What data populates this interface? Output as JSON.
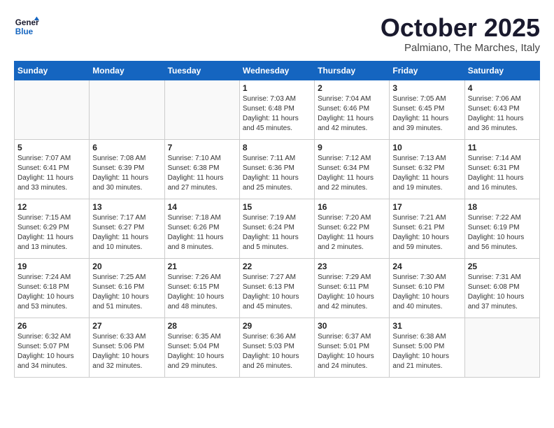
{
  "header": {
    "logo_line1": "General",
    "logo_line2": "Blue",
    "month": "October 2025",
    "location": "Palmiano, The Marches, Italy"
  },
  "weekdays": [
    "Sunday",
    "Monday",
    "Tuesday",
    "Wednesday",
    "Thursday",
    "Friday",
    "Saturday"
  ],
  "weeks": [
    [
      {
        "day": "",
        "info": ""
      },
      {
        "day": "",
        "info": ""
      },
      {
        "day": "",
        "info": ""
      },
      {
        "day": "1",
        "info": "Sunrise: 7:03 AM\nSunset: 6:48 PM\nDaylight: 11 hours and 45 minutes."
      },
      {
        "day": "2",
        "info": "Sunrise: 7:04 AM\nSunset: 6:46 PM\nDaylight: 11 hours and 42 minutes."
      },
      {
        "day": "3",
        "info": "Sunrise: 7:05 AM\nSunset: 6:45 PM\nDaylight: 11 hours and 39 minutes."
      },
      {
        "day": "4",
        "info": "Sunrise: 7:06 AM\nSunset: 6:43 PM\nDaylight: 11 hours and 36 minutes."
      }
    ],
    [
      {
        "day": "5",
        "info": "Sunrise: 7:07 AM\nSunset: 6:41 PM\nDaylight: 11 hours and 33 minutes."
      },
      {
        "day": "6",
        "info": "Sunrise: 7:08 AM\nSunset: 6:39 PM\nDaylight: 11 hours and 30 minutes."
      },
      {
        "day": "7",
        "info": "Sunrise: 7:10 AM\nSunset: 6:38 PM\nDaylight: 11 hours and 27 minutes."
      },
      {
        "day": "8",
        "info": "Sunrise: 7:11 AM\nSunset: 6:36 PM\nDaylight: 11 hours and 25 minutes."
      },
      {
        "day": "9",
        "info": "Sunrise: 7:12 AM\nSunset: 6:34 PM\nDaylight: 11 hours and 22 minutes."
      },
      {
        "day": "10",
        "info": "Sunrise: 7:13 AM\nSunset: 6:32 PM\nDaylight: 11 hours and 19 minutes."
      },
      {
        "day": "11",
        "info": "Sunrise: 7:14 AM\nSunset: 6:31 PM\nDaylight: 11 hours and 16 minutes."
      }
    ],
    [
      {
        "day": "12",
        "info": "Sunrise: 7:15 AM\nSunset: 6:29 PM\nDaylight: 11 hours and 13 minutes."
      },
      {
        "day": "13",
        "info": "Sunrise: 7:17 AM\nSunset: 6:27 PM\nDaylight: 11 hours and 10 minutes."
      },
      {
        "day": "14",
        "info": "Sunrise: 7:18 AM\nSunset: 6:26 PM\nDaylight: 11 hours and 8 minutes."
      },
      {
        "day": "15",
        "info": "Sunrise: 7:19 AM\nSunset: 6:24 PM\nDaylight: 11 hours and 5 minutes."
      },
      {
        "day": "16",
        "info": "Sunrise: 7:20 AM\nSunset: 6:22 PM\nDaylight: 11 hours and 2 minutes."
      },
      {
        "day": "17",
        "info": "Sunrise: 7:21 AM\nSunset: 6:21 PM\nDaylight: 10 hours and 59 minutes."
      },
      {
        "day": "18",
        "info": "Sunrise: 7:22 AM\nSunset: 6:19 PM\nDaylight: 10 hours and 56 minutes."
      }
    ],
    [
      {
        "day": "19",
        "info": "Sunrise: 7:24 AM\nSunset: 6:18 PM\nDaylight: 10 hours and 53 minutes."
      },
      {
        "day": "20",
        "info": "Sunrise: 7:25 AM\nSunset: 6:16 PM\nDaylight: 10 hours and 51 minutes."
      },
      {
        "day": "21",
        "info": "Sunrise: 7:26 AM\nSunset: 6:15 PM\nDaylight: 10 hours and 48 minutes."
      },
      {
        "day": "22",
        "info": "Sunrise: 7:27 AM\nSunset: 6:13 PM\nDaylight: 10 hours and 45 minutes."
      },
      {
        "day": "23",
        "info": "Sunrise: 7:29 AM\nSunset: 6:11 PM\nDaylight: 10 hours and 42 minutes."
      },
      {
        "day": "24",
        "info": "Sunrise: 7:30 AM\nSunset: 6:10 PM\nDaylight: 10 hours and 40 minutes."
      },
      {
        "day": "25",
        "info": "Sunrise: 7:31 AM\nSunset: 6:08 PM\nDaylight: 10 hours and 37 minutes."
      }
    ],
    [
      {
        "day": "26",
        "info": "Sunrise: 6:32 AM\nSunset: 5:07 PM\nDaylight: 10 hours and 34 minutes."
      },
      {
        "day": "27",
        "info": "Sunrise: 6:33 AM\nSunset: 5:06 PM\nDaylight: 10 hours and 32 minutes."
      },
      {
        "day": "28",
        "info": "Sunrise: 6:35 AM\nSunset: 5:04 PM\nDaylight: 10 hours and 29 minutes."
      },
      {
        "day": "29",
        "info": "Sunrise: 6:36 AM\nSunset: 5:03 PM\nDaylight: 10 hours and 26 minutes."
      },
      {
        "day": "30",
        "info": "Sunrise: 6:37 AM\nSunset: 5:01 PM\nDaylight: 10 hours and 24 minutes."
      },
      {
        "day": "31",
        "info": "Sunrise: 6:38 AM\nSunset: 5:00 PM\nDaylight: 10 hours and 21 minutes."
      },
      {
        "day": "",
        "info": ""
      }
    ]
  ]
}
